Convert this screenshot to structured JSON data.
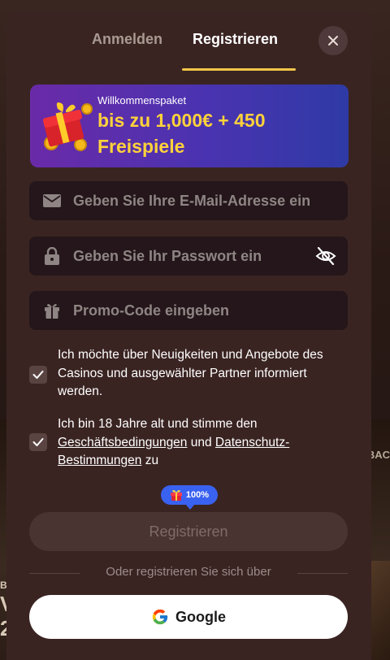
{
  "tabs": {
    "login_label": "Anmelden",
    "register_label": "Registrieren",
    "active": "register"
  },
  "banner": {
    "kicker": "Willkommenspaket",
    "headline": "bis zu 1,000€ + 450 Freispiele"
  },
  "fields": {
    "email_placeholder": "Geben Sie Ihre E-Mail-Adresse ein",
    "password_placeholder": "Geben Sie Ihr Passwort ein",
    "promo_placeholder": "Promo-Code eingeben"
  },
  "consents": {
    "news": {
      "checked": true,
      "text": "Ich möchte über Neuigkeiten und Angebote des Casinos und ausgewählter Partner informiert werden."
    },
    "age": {
      "checked": true,
      "text_before": "Ich bin 18 Jahre alt und stimme den ",
      "terms_link": "Geschäftsbedingungen",
      "text_middle": " und ",
      "privacy_link": "Datenschutz-Bestimmungen",
      "text_after": " zu"
    }
  },
  "badge": {
    "percent": "100%"
  },
  "submit_label": "Registrieren",
  "divider_text": "Oder registrieren Sie sich über",
  "google_label": "Google",
  "background": {
    "left_text_lines": [
      "B",
      "V",
      "2"
    ],
    "right_text": "BAC"
  },
  "colors": {
    "accent": "#f5c64a",
    "modal_bg": "#3a2422",
    "field_bg": "#24161a",
    "banner_headline": "#ffd23a",
    "badge_bg": "#3a62f0"
  },
  "icons": {
    "close": "close-icon",
    "email": "envelope-icon",
    "password": "lock-icon",
    "promo": "gift-icon",
    "eye": "eye-off-icon",
    "google": "google-icon"
  }
}
